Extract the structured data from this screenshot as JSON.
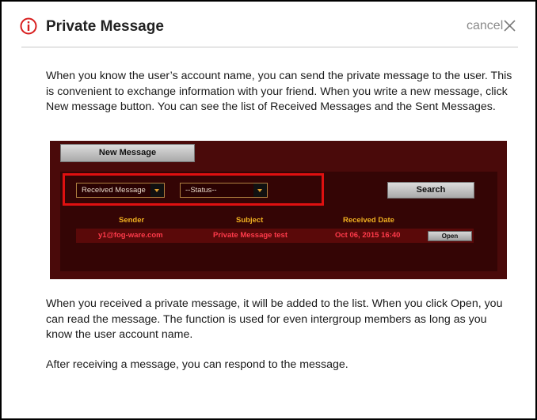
{
  "dialog": {
    "title": "Private Message",
    "cancel_label": "cancel"
  },
  "paragraphs": [
    "When you know the user’s account name, you can send the private message to the user. This is convenient to exchange information with your friend. When you write a new message, click New message button. You can see the list of Received Messages and the Sent Messages.",
    "When you received a private message, it will be added to the list. When you click Open, you can read the message. The function is used for even intergroup members as long as you know the user account name.",
    "After receiving a message, you can respond to the message."
  ],
  "screenshot": {
    "new_message_label": "New Message",
    "message_type_select": "Received Message",
    "status_select": "--Status--",
    "search_label": "Search",
    "columns": [
      "Sender",
      "Subject",
      "Received Date"
    ],
    "rows": [
      {
        "sender": "y1@fog-ware.com",
        "subject": "Private Message test",
        "received_date": "Oct 06, 2015 16:40",
        "open_label": "Open"
      }
    ]
  },
  "colors": {
    "accent_red": "#e01010",
    "panel_bg": "#4a0a0a",
    "header_text": "#f0b020",
    "row_text": "#ff3a4a"
  },
  "icons": {
    "info": "info-circle-icon",
    "close": "close-icon",
    "dropdown": "chevron-down-icon"
  }
}
